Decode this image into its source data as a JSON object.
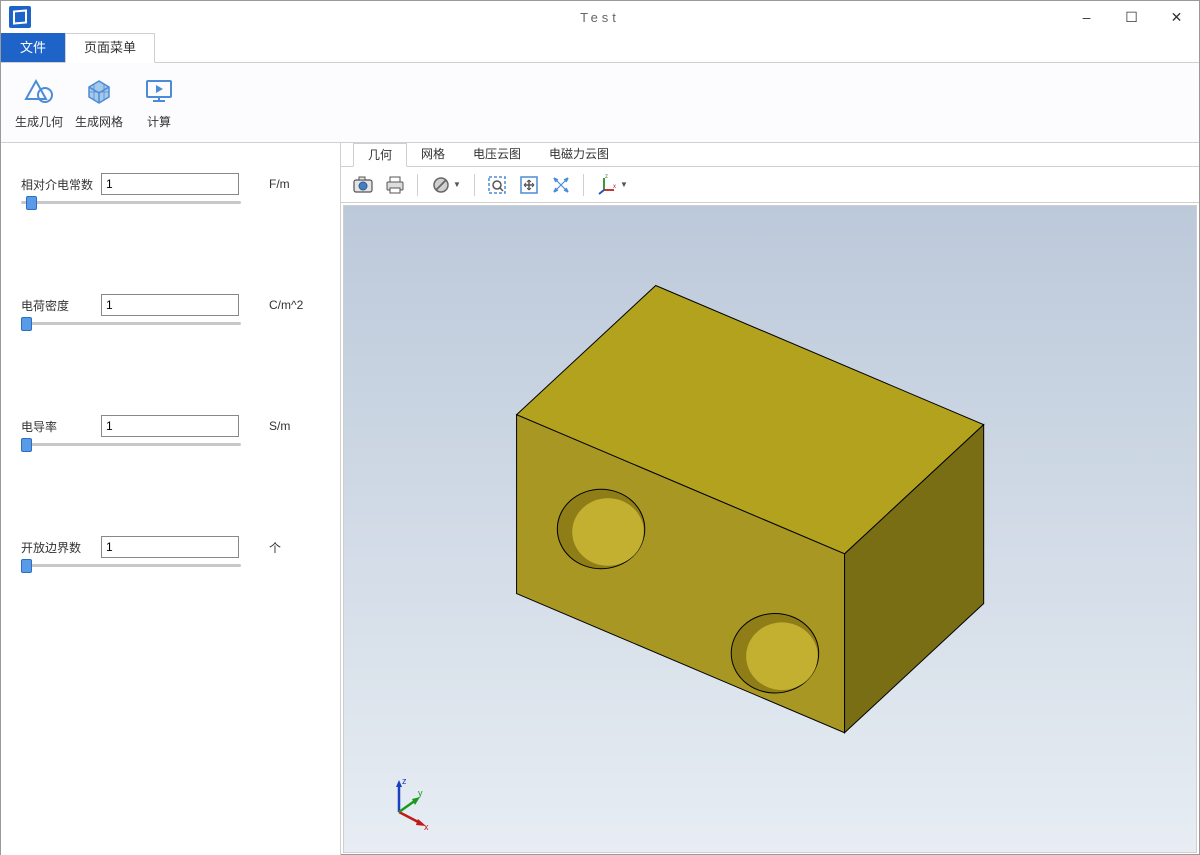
{
  "window": {
    "title": "Test",
    "minimize": "–",
    "maximize": "☐",
    "close": "✕"
  },
  "menu": {
    "file": "文件",
    "page_menu": "页面菜单"
  },
  "ribbon": {
    "gen_geometry": "生成几何",
    "gen_mesh": "生成网格",
    "compute": "计算"
  },
  "params": {
    "permittivity": {
      "label": "相对介电常数",
      "value": "1",
      "unit": "F/m"
    },
    "charge_density": {
      "label": "电荷密度",
      "value": "1",
      "unit": "C/m^2"
    },
    "conductivity": {
      "label": "电导率",
      "value": "1",
      "unit": "S/m"
    },
    "open_boundary": {
      "label": "开放边界数",
      "value": "1",
      "unit": "个"
    }
  },
  "view_tabs": {
    "geometry": "几何",
    "mesh": "网格",
    "voltage": "电压云图",
    "emforce": "电磁力云图"
  },
  "toolbar": {
    "camera": "camera-icon",
    "print": "print-icon",
    "nohide": "nohide-icon",
    "zoom_box": "zoom-box-icon",
    "fit": "fit-icon",
    "pan": "pan-icon",
    "axes": "axes-icon"
  },
  "gizmo": {
    "x": "x",
    "y": "y",
    "z": "z"
  }
}
